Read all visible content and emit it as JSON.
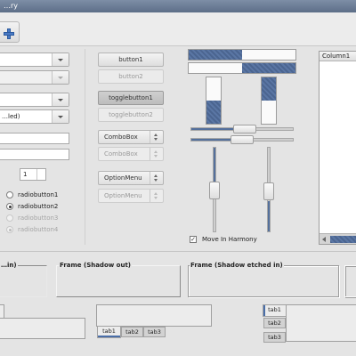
{
  "window": {
    "title": "…ry"
  },
  "buttons": {
    "button1": "button1",
    "button2": "button2",
    "togglebutton1": "togglebutton1",
    "togglebutton2": "togglebutton2"
  },
  "combo_widgets": [
    {
      "label": "ComboBox",
      "enabled": true
    },
    {
      "label": "ComboBox",
      "enabled": false
    },
    {
      "label": "OptionMenu",
      "enabled": true
    },
    {
      "label": "OptionMenu",
      "enabled": false
    }
  ],
  "left_column": {
    "combo_label": "…led)",
    "spin_value": "1"
  },
  "radios": [
    {
      "label": "radiobutton1",
      "checked": false,
      "enabled": true
    },
    {
      "label": "radiobutton2",
      "checked": true,
      "enabled": true
    },
    {
      "label": "radiobutton3",
      "checked": false,
      "enabled": false
    },
    {
      "label": "radiobutton4",
      "checked": true,
      "enabled": false
    }
  ],
  "progress": {
    "horizontal_top_fill_fraction": 0.5,
    "horizontal_bottom_fill_fraction": 0.5,
    "vertical_left_fill_fraction": 0.5,
    "vertical_right_fill_fraction": 0.5
  },
  "move_in_harmony": {
    "label": "Move In Harmony",
    "checked": true
  },
  "tree": {
    "column1": "Column1"
  },
  "frames": [
    {
      "label": "…in)"
    },
    {
      "label": "Frame (Shadow out)"
    },
    {
      "label": "Frame (Shadow etched in)"
    }
  ],
  "notebooks": {
    "bottom_tabs": [
      "tab1",
      "tab2",
      "tab3"
    ],
    "left_tabs": [
      "tab1",
      "tab2",
      "tab3"
    ]
  },
  "colors": {
    "accent": "#4b6590",
    "titlebar": "#6a7c96",
    "background": "#e4e4e4"
  },
  "icons": {
    "toolbar": "add-icon",
    "check": "check-icon"
  }
}
